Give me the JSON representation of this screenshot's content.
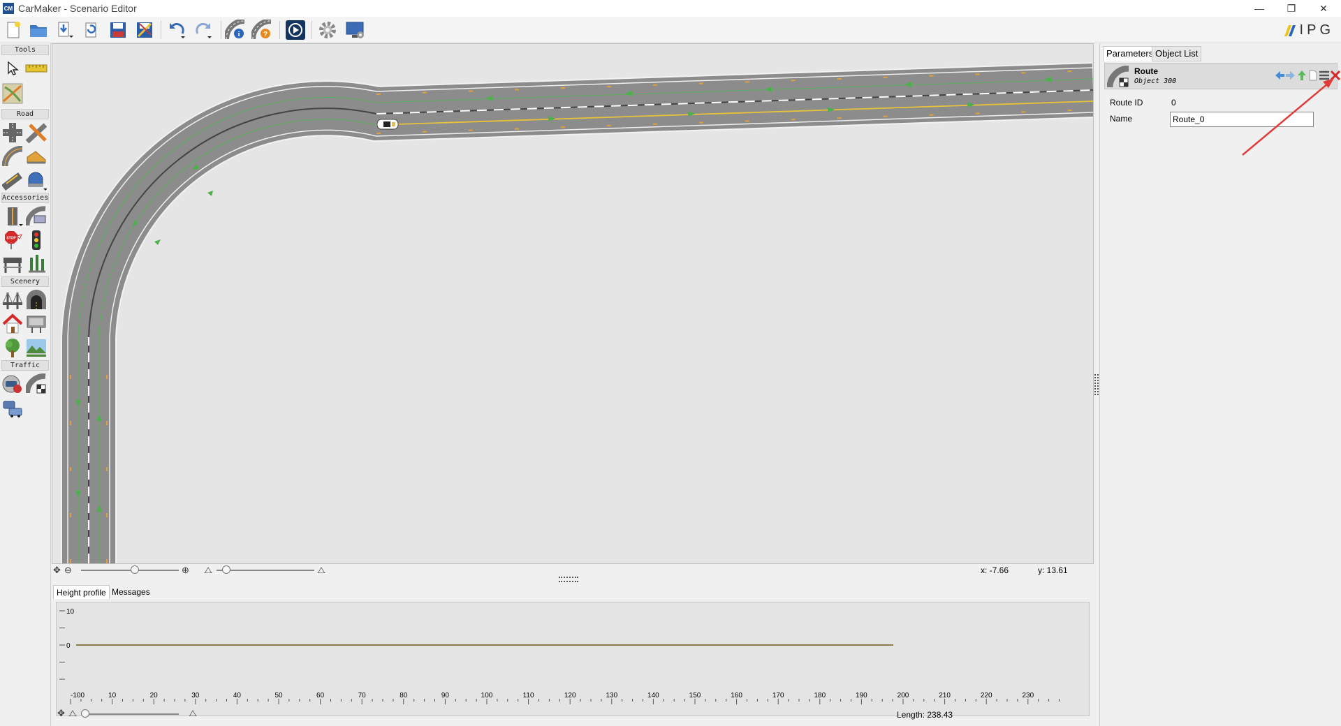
{
  "window": {
    "app_icon_text": "CM",
    "title": "CarMaker - Scenario Editor",
    "controls": {
      "minimize": "—",
      "restore": "❐",
      "close": "✕"
    }
  },
  "toolbar": {
    "items": [
      "new-file-icon",
      "open-folder-icon",
      "import-icon",
      "reload-icon",
      "save-icon",
      "save-as-icon",
      "undo-icon",
      "redo-icon",
      "road-info-icon",
      "road-help-icon",
      "play-icon",
      "settings-gear-icon",
      "monitor-settings-icon"
    ],
    "logo_text": "IPG"
  },
  "palette": {
    "sections": {
      "tools": "Tools",
      "road": "Road",
      "accessories": "Accessories",
      "scenery": "Scenery",
      "traffic": "Traffic"
    },
    "stop_sign_text": "STOP"
  },
  "canvas": {
    "zoom_level": 0.55,
    "height_scale_level": 0.1,
    "coord_x": "x: -7.66",
    "coord_y": "y: 13.61",
    "colors": {
      "background": "#e5e5e5",
      "road": "#8c8c8c",
      "lane_arrow": "#4cb04c",
      "route_line": "#e8c23a",
      "edge": "#f2f2f2"
    }
  },
  "bottom": {
    "tabs": {
      "height_profile": "Height profile",
      "messages": "Messages"
    },
    "active_tab": "Height profile",
    "length": "Length: 238.43",
    "chart_data": {
      "type": "line",
      "xlim": [
        -100,
        240
      ],
      "ylim": [
        -10,
        10
      ],
      "x_ticks": [
        "-100",
        "10",
        "20",
        "30",
        "40",
        "50",
        "60",
        "70",
        "80",
        "90",
        "100",
        "110",
        "120",
        "130",
        "140",
        "150",
        "160",
        "170",
        "180",
        "190",
        "200",
        "210",
        "220",
        "230"
      ],
      "y_ticks": [
        "10",
        "",
        "0",
        "",
        ""
      ],
      "series": [
        {
          "x": [
            -100,
            238.43
          ],
          "y": [
            0,
            0
          ],
          "color": "#6b5a12"
        }
      ]
    }
  },
  "right": {
    "tabs": {
      "parameters": "Parameters",
      "object_list": "Object List"
    },
    "object": {
      "title": "Route",
      "subtitle": "Object 300",
      "header_icons": [
        "arrow-left-icon",
        "arrow-right-icon",
        "arrow-up-icon",
        "document-icon",
        "menu-icon",
        "delete-icon"
      ]
    },
    "params": {
      "route_id_label": "Route ID",
      "route_id_value": "0",
      "name_label": "Name",
      "name_value": "Route_0"
    },
    "annotation_color": "#e03c3c"
  }
}
